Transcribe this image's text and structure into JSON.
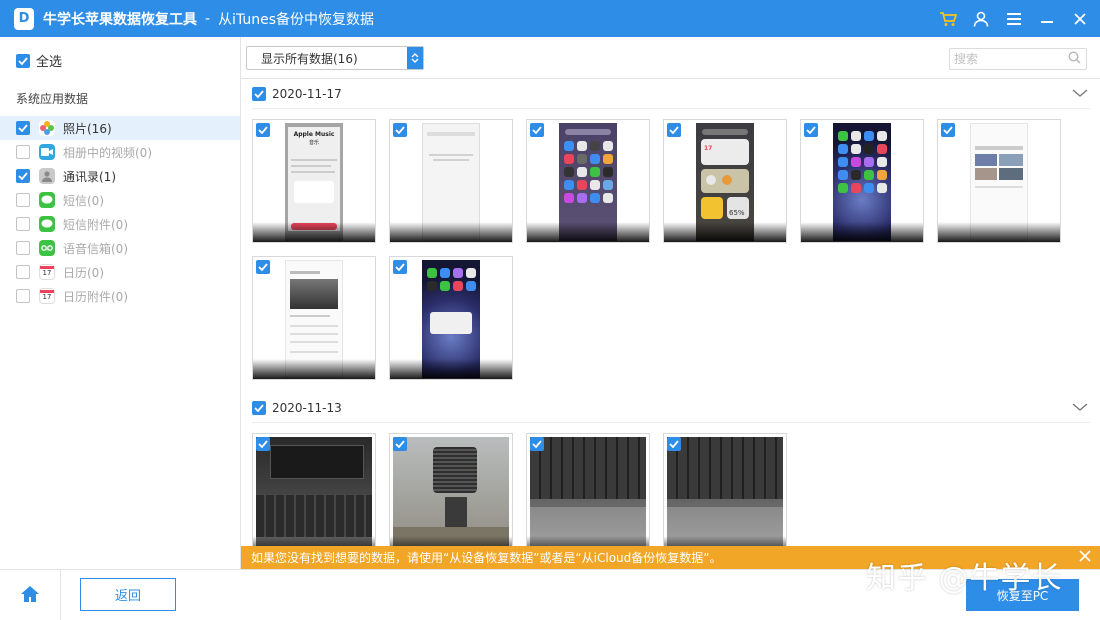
{
  "titlebar": {
    "logo_letter": "D",
    "app_name": "牛学长苹果数据恢复工具",
    "separator": "-",
    "subtitle": "从iTunes备份中恢复数据",
    "icons": [
      "cart-icon",
      "user-icon",
      "menu-icon",
      "minimize-icon",
      "close-icon"
    ]
  },
  "sidebar": {
    "select_all_label": "全选",
    "section_title": "系统应用数据",
    "items": [
      {
        "label": "照片(16)",
        "checked": true,
        "active": true,
        "icon": "photos-icon"
      },
      {
        "label": "相册中的视频(0)",
        "checked": false,
        "icon": "album-video-icon"
      },
      {
        "label": "通讯录(1)",
        "checked": true,
        "icon": "contacts-icon"
      },
      {
        "label": "短信(0)",
        "checked": false,
        "icon": "messages-icon"
      },
      {
        "label": "短信附件(0)",
        "checked": false,
        "icon": "message-attachment-icon"
      },
      {
        "label": "语音信箱(0)",
        "checked": false,
        "icon": "voicemail-icon"
      },
      {
        "label": "日历(0)",
        "checked": false,
        "icon": "calendar-icon",
        "icon_text": "17"
      },
      {
        "label": "日历附件(0)",
        "checked": false,
        "icon": "calendar-attachment-icon",
        "icon_text": "17"
      }
    ]
  },
  "toolbar": {
    "filter_value": "显示所有数据(16)",
    "search_placeholder": "搜索"
  },
  "groups": [
    {
      "date": "2020-11-17",
      "checked": true,
      "photo_count": 8
    },
    {
      "date": "2020-11-13",
      "checked": true,
      "photo_count": 4
    }
  ],
  "thumbnails": {
    "apple_music_title": "Apple Music",
    "apple_music_subtitle": "音乐",
    "battery_percent": "65%",
    "widget_date": "17"
  },
  "banner": {
    "message": "如果您没有找到想要的数据，请使用“从设备恢复数据”或者是“从iCloud备份恢复数据”。"
  },
  "bottom": {
    "back_label": "返回",
    "recover_label": "恢复至PC"
  },
  "watermark": "知乎 @牛学长",
  "colors": {
    "accent": "#2e8de6",
    "banner": "#f2a628",
    "active_row": "#e4f0fc"
  }
}
